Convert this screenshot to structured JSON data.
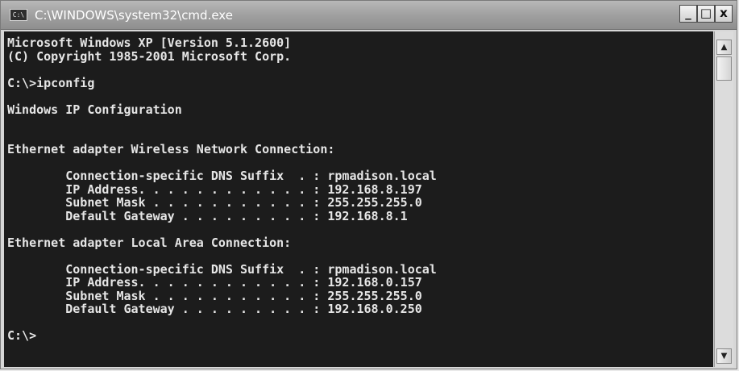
{
  "window": {
    "title": "C:\\WINDOWS\\system32\\cmd.exe",
    "app_icon": "C:\\",
    "buttons": {
      "minimize": "_",
      "maximize": "□",
      "close": "x"
    }
  },
  "console": {
    "lines": [
      "Microsoft Windows XP [Version 5.1.2600]",
      "(C) Copyright 1985-2001 Microsoft Corp.",
      "",
      "C:\\>ipconfig",
      "",
      "Windows IP Configuration",
      "",
      "",
      "Ethernet adapter Wireless Network Connection:",
      "",
      "        Connection-specific DNS Suffix  . : rpmadison.local",
      "        IP Address. . . . . . . . . . . . : 192.168.8.197",
      "        Subnet Mask . . . . . . . . . . . : 255.255.255.0",
      "        Default Gateway . . . . . . . . . : 192.168.8.1",
      "",
      "Ethernet adapter Local Area Connection:",
      "",
      "        Connection-specific DNS Suffix  . : rpmadison.local",
      "        IP Address. . . . . . . . . . . . : 192.168.0.157",
      "        Subnet Mask . . . . . . . . . . . : 255.255.255.0",
      "        Default Gateway . . . . . . . . . : 192.168.0.250",
      "",
      "C:\\>"
    ]
  },
  "scrollbar": {
    "up_arrow": "▲",
    "down_arrow": "▼"
  },
  "colors": {
    "console_background": "#1c1c1c",
    "console_text": "#e6e6e6",
    "titlebar": "#9e9e9e"
  }
}
